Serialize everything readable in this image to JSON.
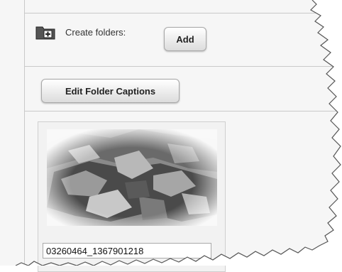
{
  "folders": {
    "create_label": "Create folders:",
    "add_button": "Add",
    "edit_captions_button": "Edit Folder Captions"
  },
  "thumbnail": {
    "caption_value": "03260464_1367901218"
  }
}
